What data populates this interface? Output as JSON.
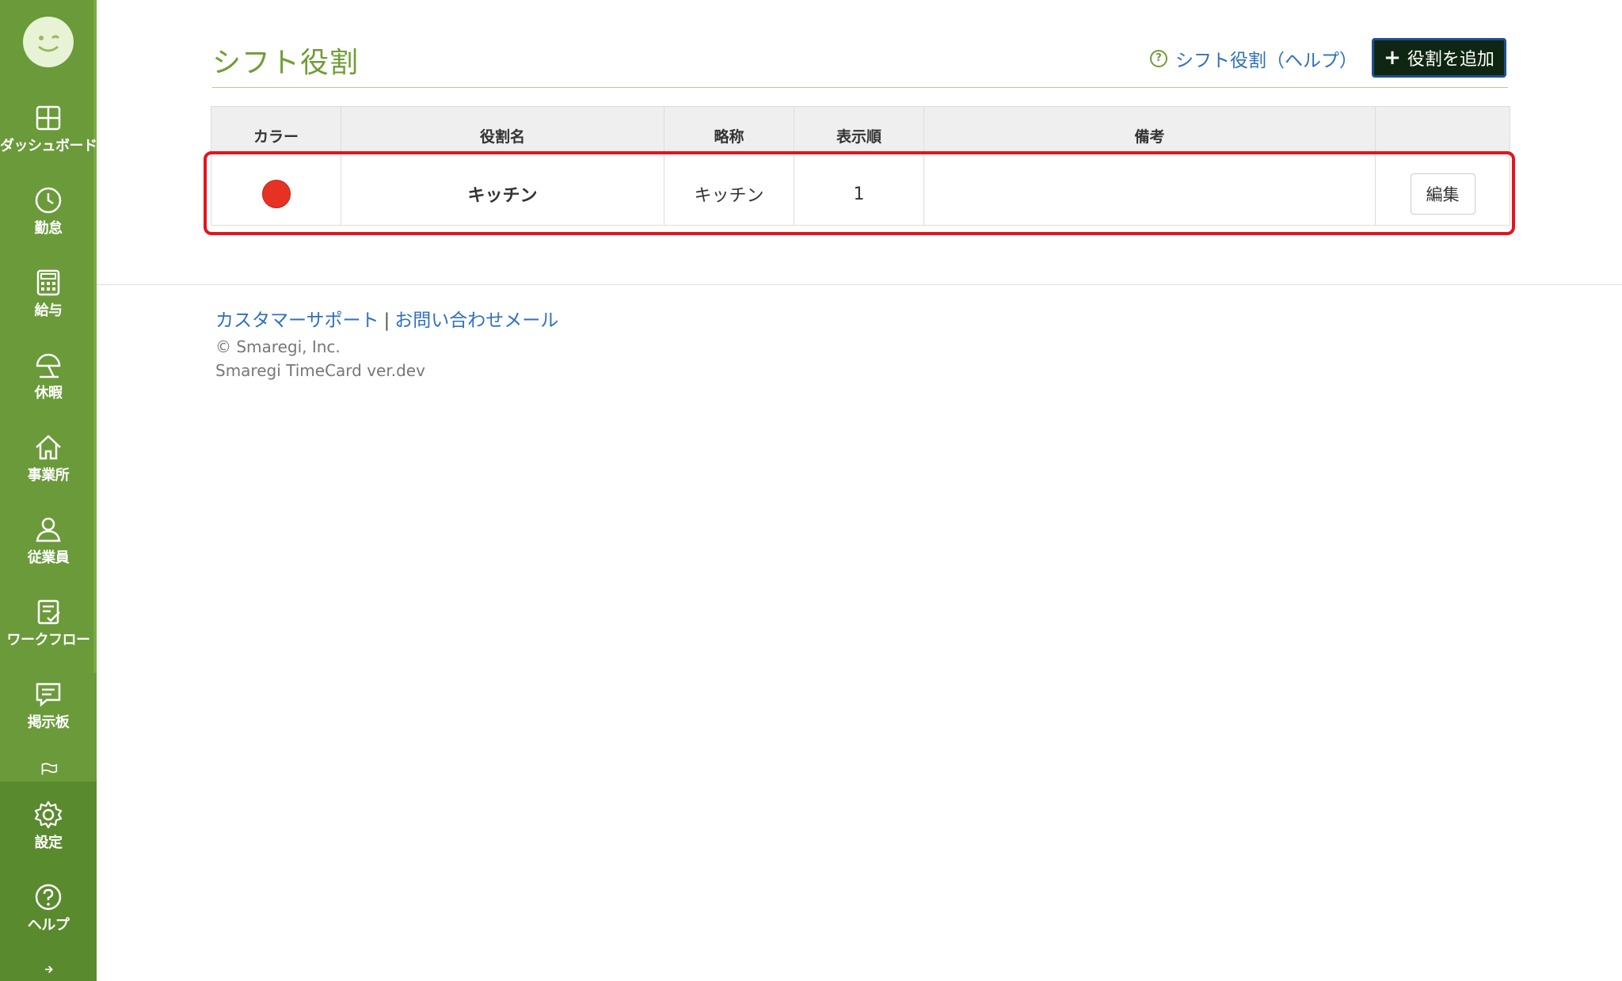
{
  "sidebar": {
    "items": [
      {
        "label": "ダッシュボード",
        "icon": "dashboard-icon"
      },
      {
        "label": "勤怠",
        "icon": "clock-icon"
      },
      {
        "label": "給与",
        "icon": "calculator-icon"
      },
      {
        "label": "休暇",
        "icon": "umbrella-icon"
      },
      {
        "label": "事業所",
        "icon": "home-icon"
      },
      {
        "label": "従業員",
        "icon": "user-icon"
      },
      {
        "label": "ワークフロー",
        "icon": "clipboard-check-icon"
      },
      {
        "label": "掲示板",
        "icon": "chat-icon"
      }
    ],
    "bottom": [
      {
        "label": "設定",
        "icon": "gear-icon"
      },
      {
        "label": "ヘルプ",
        "icon": "help-circle-icon"
      }
    ],
    "partial_icon": "flag-icon",
    "collapse_icon": "arrow-right-icon"
  },
  "header": {
    "title": "シフト役割",
    "help_link": "シフト役割（ヘルプ）",
    "add_button": "役割を追加"
  },
  "table": {
    "columns": [
      "カラー",
      "役割名",
      "略称",
      "表示順",
      "備考",
      ""
    ],
    "rows": [
      {
        "color": "#e73223",
        "name": "キッチン",
        "abbreviation": "キッチン",
        "order": "1",
        "note": "",
        "action": "編集"
      }
    ]
  },
  "footer": {
    "support_link": "カスタマーサポート",
    "separator": "|",
    "mail_link": "お問い合わせメール",
    "copyright": "© Smaregi, Inc.",
    "version": "Smaregi TimeCard ver.dev"
  },
  "colors": {
    "sidebar": "#6a9a3a",
    "title": "#6f9d35",
    "link": "#2f6fc1",
    "highlight": "#e4141e"
  }
}
